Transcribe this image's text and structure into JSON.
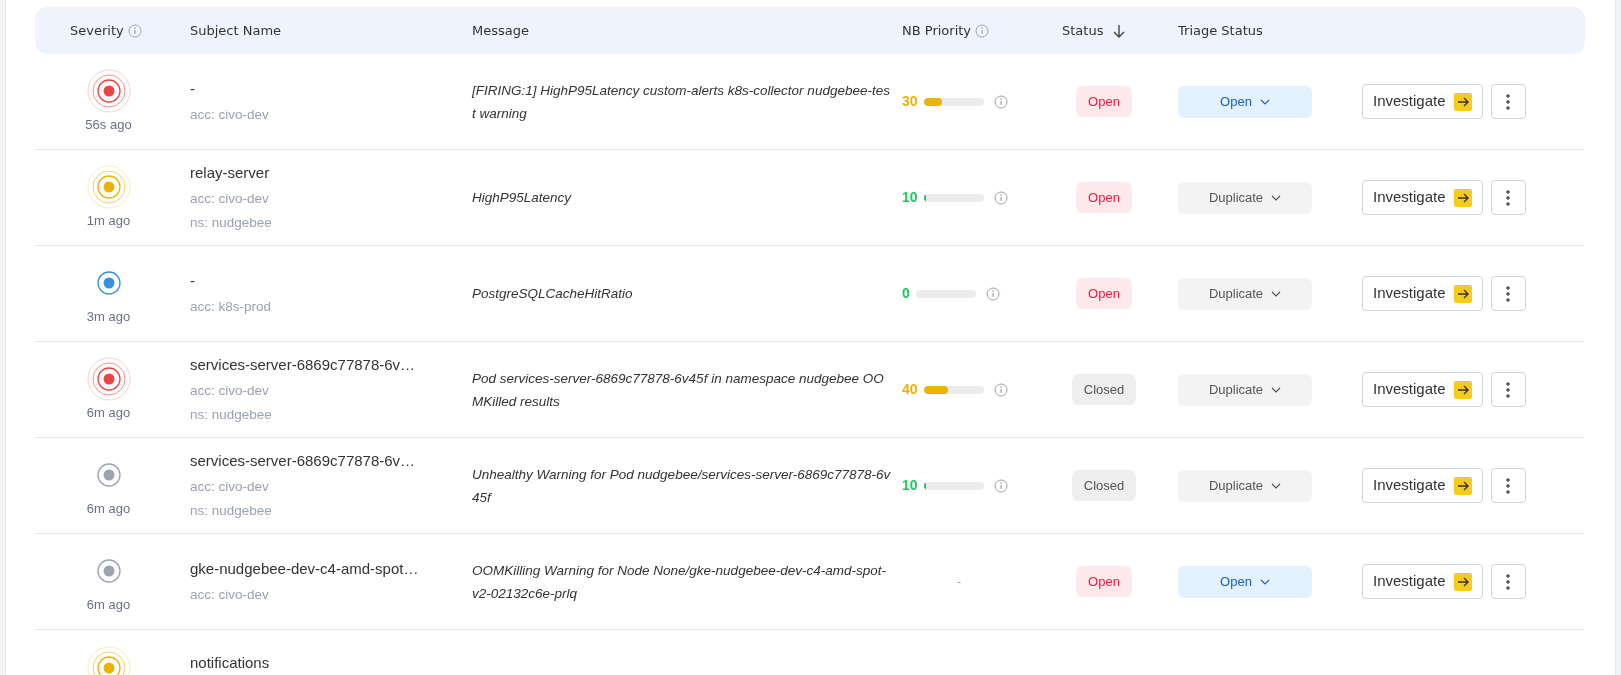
{
  "columns": [
    {
      "label": "Severity",
      "info": true,
      "sorted": false
    },
    {
      "label": "Subject Name",
      "info": false,
      "sorted": false
    },
    {
      "label": "Message",
      "info": false,
      "sorted": false
    },
    {
      "label": "NB Priority",
      "info": true,
      "sorted": false
    },
    {
      "label": "Status",
      "info": false,
      "sorted": true
    },
    {
      "label": "Triage Status",
      "info": false,
      "sorted": false
    }
  ],
  "rows": [
    {
      "severity": {
        "color": "#ef4444",
        "rings": true
      },
      "age": "56s ago",
      "subject": "-",
      "account": "acc: civo-dev",
      "message": "[FIRING:1] HighP95Latency custom-alerts k8s-collector nudgebee-test warning",
      "priority": {
        "value": "30",
        "level": 0.3,
        "color": "#eab308"
      },
      "status": {
        "label": "Open",
        "kind": "open"
      },
      "triage": {
        "label": "Open",
        "kind": "open"
      },
      "investigate": "Investigate"
    },
    {
      "severity": {
        "color": "#eab308",
        "rings": true
      },
      "age": "1m ago",
      "subject": "relay-server",
      "account": "acc: civo-dev",
      "namespace": "ns: nudgebee",
      "message": "HighP95Latency",
      "priority": {
        "value": "10",
        "level": 0.04,
        "color": "#22c55e"
      },
      "status": {
        "label": "Open",
        "kind": "open"
      },
      "triage": {
        "label": "Duplicate",
        "kind": "duplicate"
      },
      "investigate": "Investigate"
    },
    {
      "severity": {
        "color": "#3b8fdd",
        "rings": false
      },
      "age": "3m ago",
      "subject": "-",
      "account": "acc: k8s-prod",
      "message": "PostgreSQLCacheHitRatio",
      "priority": {
        "value": "0",
        "level": 0,
        "color": "#22c55e"
      },
      "status": {
        "label": "Open",
        "kind": "open"
      },
      "triage": {
        "label": "Duplicate",
        "kind": "duplicate"
      },
      "investigate": "Investigate"
    },
    {
      "severity": {
        "color": "#ef4444",
        "rings": true
      },
      "age": "6m ago",
      "subject": "services-server-6869c77878-6v…",
      "account": "acc: civo-dev",
      "namespace": "ns: nudgebee",
      "message": "Pod services-server-6869c77878-6v45f in namespace nudgebee OOMKilled results",
      "priority": {
        "value": "40",
        "level": 0.4,
        "color": "#eab308"
      },
      "status": {
        "label": "Closed",
        "kind": "closed"
      },
      "triage": {
        "label": "Duplicate",
        "kind": "duplicate"
      },
      "investigate": "Investigate"
    },
    {
      "severity": {
        "color": "#9ca3af",
        "rings": false
      },
      "age": "6m ago",
      "subject": "services-server-6869c77878-6v…",
      "account": "acc: civo-dev",
      "namespace": "ns: nudgebee",
      "message": "Unhealthy Warning for Pod nudgebee/services-server-6869c77878-6v45f",
      "priority": {
        "value": "10",
        "level": 0.04,
        "color": "#22c55e"
      },
      "status": {
        "label": "Closed",
        "kind": "closed"
      },
      "triage": {
        "label": "Duplicate",
        "kind": "duplicate"
      },
      "investigate": "Investigate"
    },
    {
      "severity": {
        "color": "#9ca3af",
        "rings": false
      },
      "age": "6m ago",
      "subject": "gke-nudgebee-dev-c4-amd-spot…",
      "account": "acc: civo-dev",
      "message": "OOMKilling Warning for Node None/gke-nudgebee-dev-c4-amd-spot-v2-02132c6e-prlq",
      "priority_empty": "-",
      "status": {
        "label": "Open",
        "kind": "open"
      },
      "triage": {
        "label": "Open",
        "kind": "open"
      },
      "investigate": "Investigate"
    },
    {
      "severity": {
        "color": "#eab308",
        "rings": true
      },
      "subject": "notifications"
    }
  ]
}
